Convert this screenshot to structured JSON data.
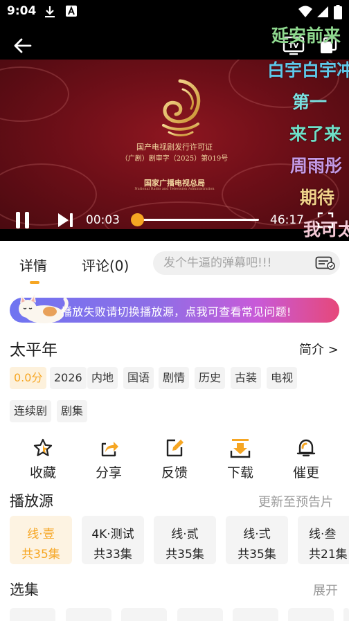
{
  "status_bar": {
    "time": "9:04",
    "icons": [
      "download-icon",
      "keyboard-a-icon",
      "wifi-icon",
      "signal-icon",
      "battery-icon"
    ]
  },
  "player": {
    "certificate": {
      "line1": "国产电视剧发行许可证",
      "line2": "（广剧）剧审字（2025）第019号",
      "line3": "国家广播电视总局",
      "line4": "National Radio and Television Administration"
    },
    "danmaku": [
      {
        "text": "延安前来",
        "color": "#8fd98f"
      },
      {
        "text": "白宇白宇冲",
        "color": "#5ec7e8"
      },
      {
        "text": "第一",
        "color": "#7be0e0"
      },
      {
        "text": "来了来",
        "color": "#6fe0c8"
      },
      {
        "text": "周雨彤",
        "color": "#c59ae6"
      },
      {
        "text": "期待",
        "color": "#f0d28a"
      },
      {
        "text": "我可太",
        "color": "#f3c9d6"
      }
    ],
    "current_time": "00:03",
    "total_time": "46:17",
    "progress": 0.001
  },
  "tabs": {
    "detail": "详情",
    "comments": "评论(0)",
    "danmaku_placeholder": "发个牛逼的弹幕吧!!!"
  },
  "banner": {
    "text": "播放失败请切换播放源，点我可查看常见问题!"
  },
  "show": {
    "title": "太平年",
    "intro_link": "简介 >",
    "tags": [
      "0.0分",
      "2026",
      "内地",
      "国语",
      "剧情",
      "历史",
      "古装",
      "电视",
      "连续剧",
      "剧集"
    ]
  },
  "actions": [
    {
      "label": "收藏",
      "icon": "star-icon"
    },
    {
      "label": "分享",
      "icon": "share-icon"
    },
    {
      "label": "反馈",
      "icon": "edit-icon"
    },
    {
      "label": "下载",
      "icon": "download-icon"
    },
    {
      "label": "催更",
      "icon": "bell-icon"
    }
  ],
  "sources": {
    "title": "播放源",
    "update_note": "更新至预告片",
    "items": [
      {
        "name": "线·壹",
        "count": "共35集"
      },
      {
        "name": "4K·测试",
        "count": "共33集"
      },
      {
        "name": "线·贰",
        "count": "共35集"
      },
      {
        "name": "线·弍",
        "count": "共35集"
      },
      {
        "name": "线·叁",
        "count": "共21集"
      }
    ]
  },
  "episodes": {
    "title": "选集",
    "expand": "展开"
  },
  "colors": {
    "accent": "#f6a623",
    "banner_start": "#6f74f1",
    "banner_end": "#e6487a"
  }
}
